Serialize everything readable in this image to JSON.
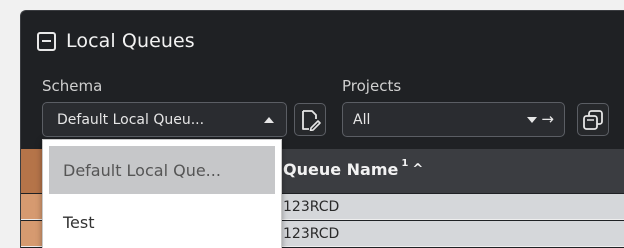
{
  "panel": {
    "title": "Local Queues",
    "title_icon": "collapse-square-icon"
  },
  "filters": {
    "schema_label": "Schema",
    "schema_value": "Default Local Queu...",
    "projects_label": "Projects",
    "projects_value": "All",
    "edit_icon": "edit-document-icon",
    "copy_icon": "copy-icon"
  },
  "schema_dropdown": {
    "options": [
      {
        "label": "Default Local Que...",
        "selected": true
      },
      {
        "label": "Test",
        "selected": false
      }
    ]
  },
  "table": {
    "column_header": "Queue Name",
    "sort_order": "1",
    "sort_direction": "ascending",
    "rows": [
      {
        "queue_name": "123RCD"
      },
      {
        "queue_name": "123RCD"
      }
    ]
  },
  "colors": {
    "panel_bg": "#1f2124",
    "header_accent": "#b57449",
    "row_accent": "#d69a70",
    "row_bg": "#d5d7da",
    "selected_option_bg": "#c6c7c9"
  }
}
